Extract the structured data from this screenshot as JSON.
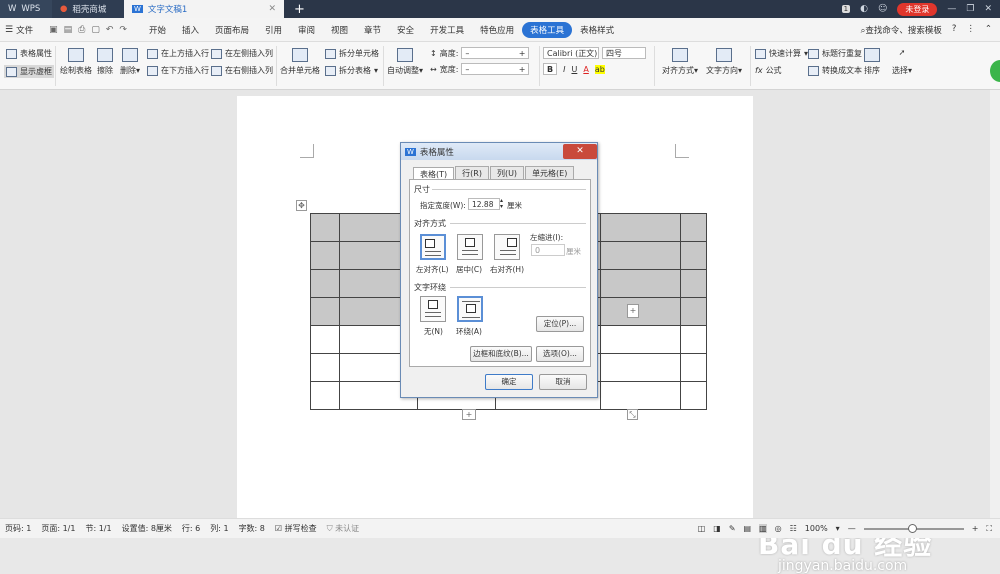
{
  "titlebar": {
    "tabs": [
      {
        "label": "WPS"
      },
      {
        "label": "稻壳商城"
      },
      {
        "label": "文字文稿1"
      }
    ],
    "page_count_badge": "1",
    "login_label": "未登录"
  },
  "menubar": {
    "file_label": "文件",
    "items": [
      "开始",
      "插入",
      "页面布局",
      "引用",
      "审阅",
      "视图",
      "章节",
      "安全",
      "开发工具",
      "特色应用",
      "表格工具",
      "表格样式"
    ],
    "active": "表格工具",
    "search_label": "查找命令、搜索模板"
  },
  "ribbon": {
    "table_properties": "表格属性",
    "show_gridlines": "显示虚框",
    "draw_table": "绘制表格",
    "erase": "擦除",
    "delete": "删除",
    "insert_above": "在上方插入行",
    "insert_below": "在下方插入行",
    "insert_left": "在左侧插入列",
    "insert_right": "在右侧插入列",
    "merge_cells": "合并单元格",
    "split_cells": "拆分单元格",
    "split_table": "拆分表格",
    "auto_fit": "自动调整",
    "height_label": "高度:",
    "width_label": "宽度:",
    "font_name": "Calibri (正文)",
    "font_size": "四号",
    "bold": "B",
    "italic": "I",
    "underline": "U",
    "font_color": "A",
    "highlight": "ab",
    "align_label": "对齐方式",
    "text_direction": "文字方向",
    "quick_calc": "快速计算",
    "formula": "公式",
    "repeat_header": "标题行重复",
    "convert_text": "转换成文本",
    "sort": "排序",
    "select": "选择"
  },
  "dialog": {
    "title": "表格属性",
    "tabs": [
      "表格(T)",
      "行(R)",
      "列(U)",
      "单元格(E)"
    ],
    "size_group": "尺寸",
    "width_label": "指定宽度(W):",
    "width_value": "12.88",
    "width_unit": "厘米",
    "align_group": "对齐方式",
    "align_options": [
      "左对齐(L)",
      "居中(C)",
      "右对齐(H)"
    ],
    "indent_label": "左缩进(I):",
    "indent_value": "0",
    "indent_unit": "厘米",
    "wrap_group": "文字环绕",
    "wrap_options": [
      "无(N)",
      "环绕(A)"
    ],
    "position_button": "定位(P)...",
    "border_button": "边框和底纹(B)...",
    "options_button": "选项(O)...",
    "ok_button": "确定",
    "cancel_button": "取消"
  },
  "statusbar": {
    "page_number": "页码: 1",
    "page": "页面: 1/1",
    "section": "节: 1/1",
    "setting": "设置值: 8厘米",
    "row": "行: 6",
    "col": "列: 1",
    "word_count": "字数: 8",
    "spell_check": "拼写检查",
    "certify": "未认证",
    "zoom": "100%"
  },
  "watermark": {
    "brand": "Bai du 经验",
    "url": "jingyan.baidu.com"
  }
}
